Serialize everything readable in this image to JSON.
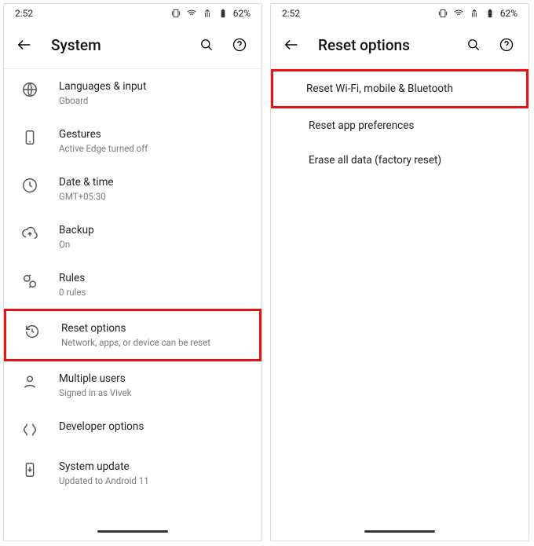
{
  "status": {
    "time": "2:52",
    "battery": "62%"
  },
  "left": {
    "title": "System",
    "items": [
      {
        "label": "Languages & input",
        "sub": "Gboard"
      },
      {
        "label": "Gestures",
        "sub": "Active Edge turned off"
      },
      {
        "label": "Date & time",
        "sub": "GMT+05:30"
      },
      {
        "label": "Backup",
        "sub": "On"
      },
      {
        "label": "Rules",
        "sub": "0 rules"
      },
      {
        "label": "Reset options",
        "sub": "Network, apps, or device can be reset"
      },
      {
        "label": "Multiple users",
        "sub": "Signed in as Vivek"
      },
      {
        "label": "Developer options",
        "sub": ""
      },
      {
        "label": "System update",
        "sub": "Updated to Android 11"
      }
    ]
  },
  "right": {
    "title": "Reset options",
    "items": [
      {
        "label": "Reset Wi-Fi, mobile & Bluetooth"
      },
      {
        "label": "Reset app preferences"
      },
      {
        "label": "Erase all data (factory reset)"
      }
    ]
  }
}
